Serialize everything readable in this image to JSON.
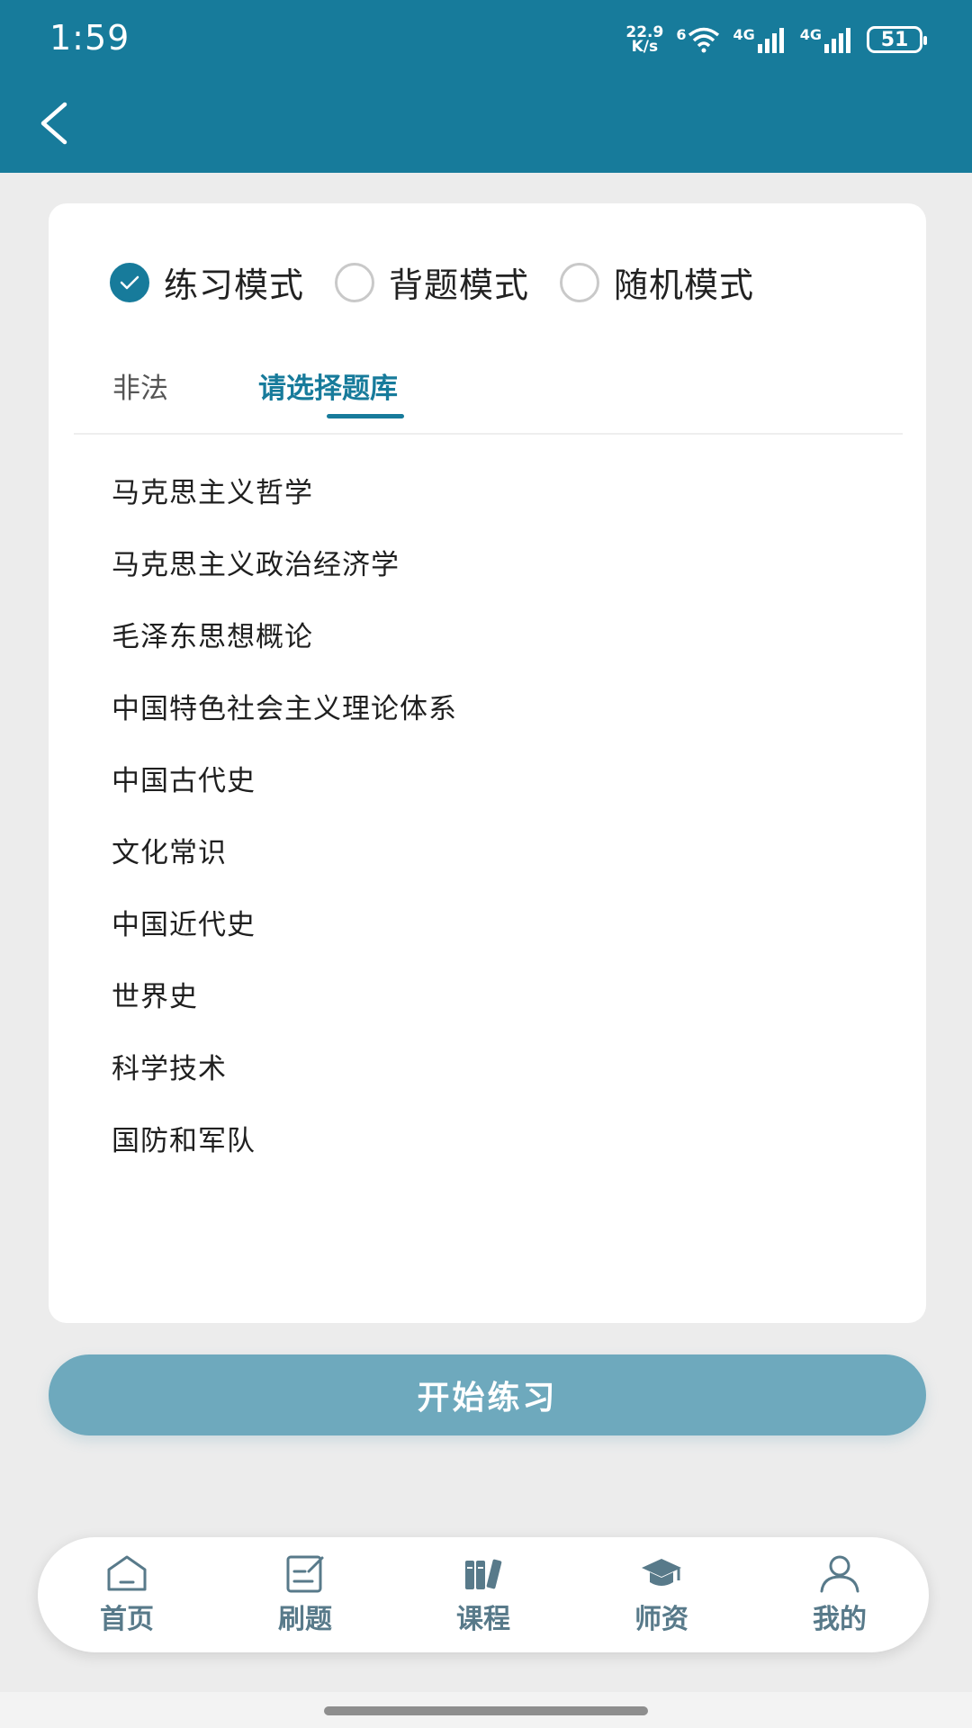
{
  "status": {
    "time": "1:59",
    "net_speed_top": "22.9",
    "net_speed_bottom": "K/s",
    "wifi_label": "6",
    "signal1": "4G",
    "signal2": "4G",
    "battery": "51"
  },
  "modes": [
    {
      "label": "练习模式",
      "checked": true
    },
    {
      "label": "背题模式",
      "checked": false
    },
    {
      "label": "随机模式",
      "checked": false
    }
  ],
  "tabs": {
    "illegal": "非法",
    "bank": "请选择题库"
  },
  "subjects": [
    "马克思主义哲学",
    "马克思主义政治经济学",
    "毛泽东思想概论",
    "中国特色社会主义理论体系",
    "中国古代史",
    "文化常识",
    "中国近代史",
    "世界史",
    "科学技术",
    "国防和军队"
  ],
  "start_button": "开始练习",
  "nav": [
    {
      "label": "首页",
      "icon": "home-icon"
    },
    {
      "label": "刷题",
      "icon": "edit-note-icon"
    },
    {
      "label": "课程",
      "icon": "books-icon"
    },
    {
      "label": "师资",
      "icon": "graduation-cap-icon"
    },
    {
      "label": "我的",
      "icon": "user-icon"
    }
  ],
  "colors": {
    "primary": "#177b9b",
    "button": "#6ea9bd",
    "nav_label": "#587a8a"
  }
}
